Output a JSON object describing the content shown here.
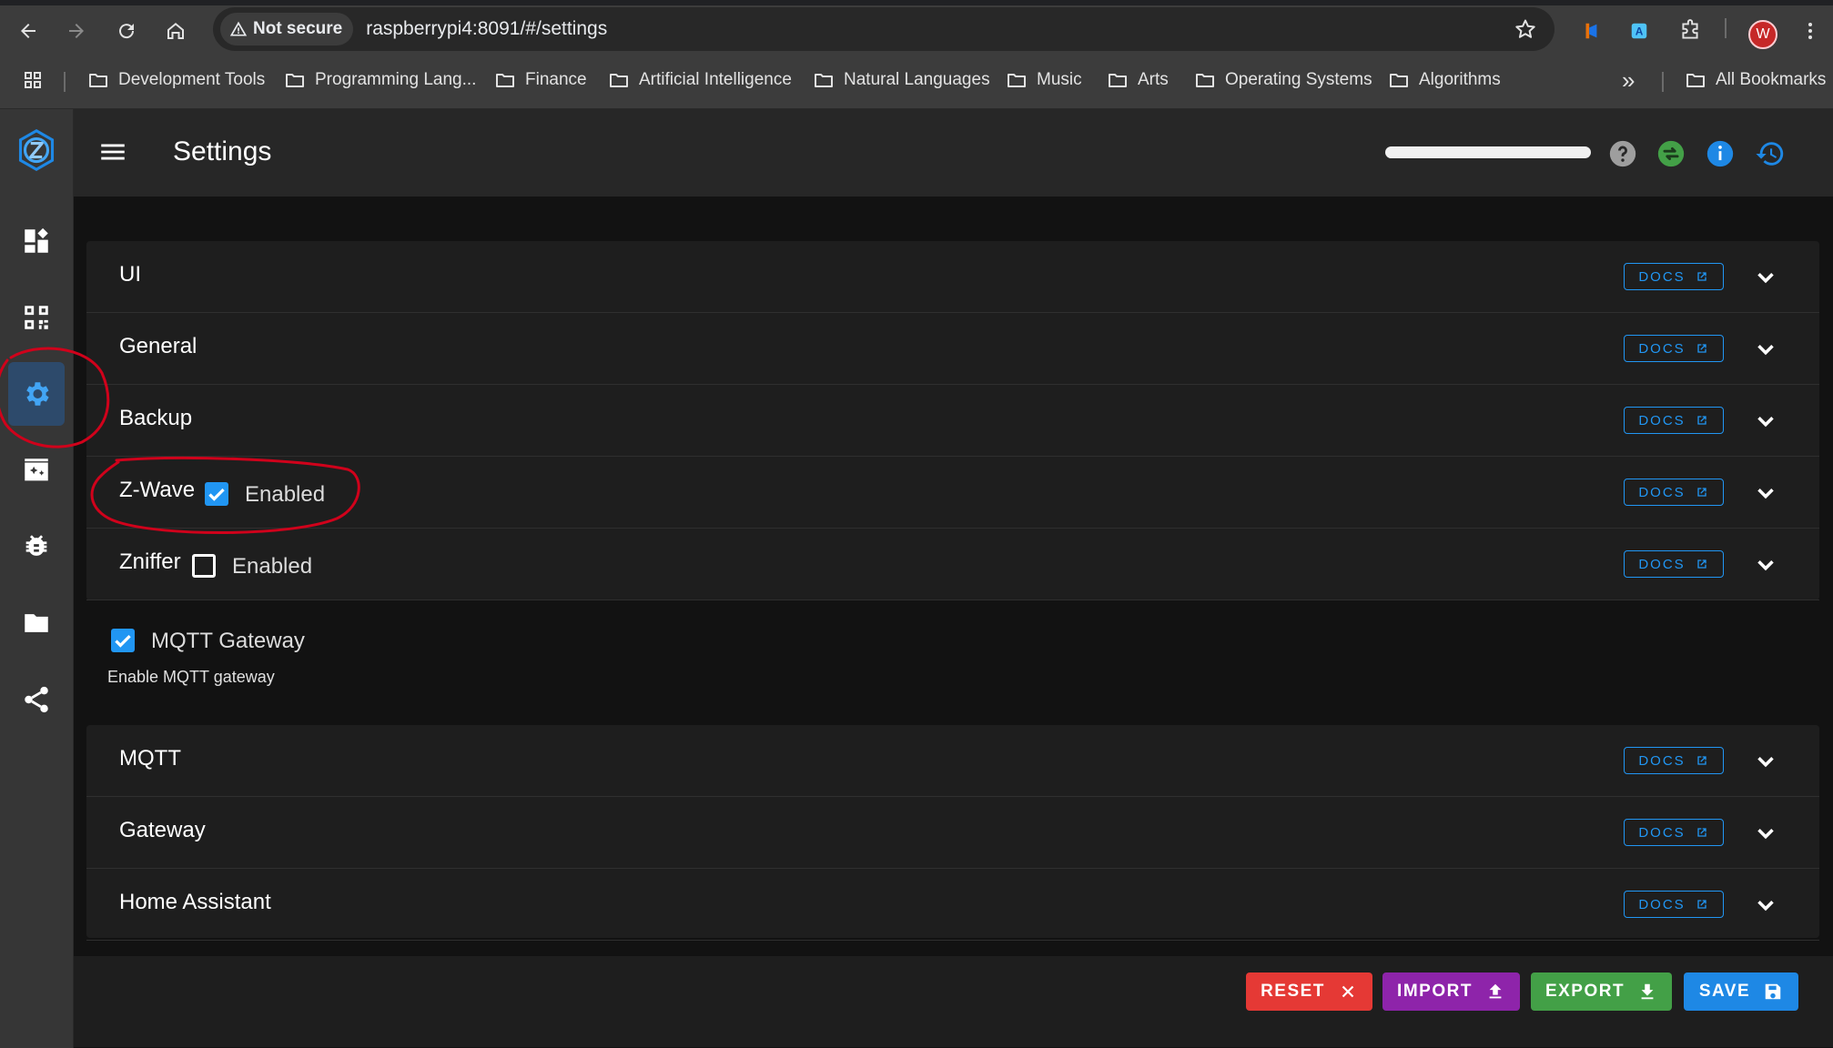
{
  "browser": {
    "security_label": "Not secure",
    "url": "raspberrypi4:8091/#/settings",
    "profile_initial": "W",
    "bookmarks": [
      "Development Tools",
      "Programming Lang...",
      "Finance",
      "Artificial Intelligence",
      "Natural Languages",
      "Music",
      "Arts",
      "Operating Systems",
      "Algorithms"
    ],
    "all_bookmarks_label": "All Bookmarks",
    "overflow_label": "»"
  },
  "app": {
    "title": "Settings",
    "sidebar_items": [
      "dashboard-icon",
      "qr-code-icon",
      "gear-icon",
      "scenes-icon",
      "debug-icon",
      "folder-icon",
      "share-icon"
    ],
    "active_sidebar_item": "gear-icon"
  },
  "sections_top": [
    {
      "title": "UI",
      "docs_label": "DOCS"
    },
    {
      "title": "General",
      "docs_label": "DOCS"
    },
    {
      "title": "Backup",
      "docs_label": "DOCS"
    },
    {
      "title": "Z-Wave",
      "docs_label": "DOCS",
      "toggle_label": "Enabled",
      "toggle_checked": true
    },
    {
      "title": "Zniffer",
      "docs_label": "DOCS",
      "toggle_label": "Enabled",
      "toggle_checked": false
    }
  ],
  "mqtt_gateway": {
    "label": "MQTT Gateway",
    "checked": true,
    "hint": "Enable MQTT gateway"
  },
  "sections_bottom": [
    {
      "title": "MQTT",
      "docs_label": "DOCS"
    },
    {
      "title": "Gateway",
      "docs_label": "DOCS"
    },
    {
      "title": "Home Assistant",
      "docs_label": "DOCS"
    }
  ],
  "actions": {
    "reset": "RESET",
    "import": "IMPORT",
    "export": "EXPORT",
    "save": "SAVE"
  },
  "colors": {
    "reset": "#e53935",
    "import": "#8e24aa",
    "export": "#43a047",
    "save": "#1e88e5",
    "accent": "#2196f3",
    "annotation": "#d0021b"
  }
}
